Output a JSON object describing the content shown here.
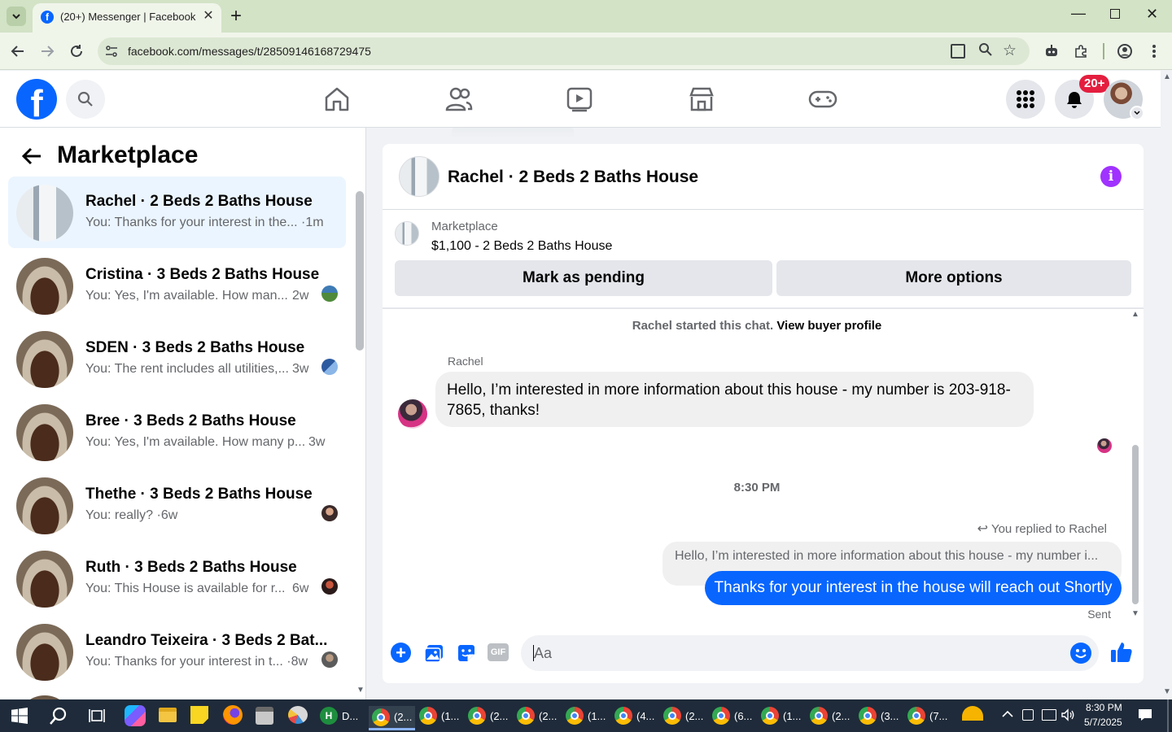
{
  "browser": {
    "tab_title": "(20+) Messenger | Facebook",
    "new_tab": "+",
    "url": "facebook.com/messages/t/28509146168729475"
  },
  "nav": {
    "notification_badge": "20+"
  },
  "left": {
    "title": "Marketplace",
    "conversations": [
      {
        "title": "Rachel · 2 Beds 2 Baths House",
        "preview": "You: Thanks for your interest in the...",
        "time": "·1m"
      },
      {
        "title": "Cristina · 3 Beds 2 Baths House",
        "preview": "You: Yes, I'm available. How man...",
        "time": "2w"
      },
      {
        "title": "SDEN · 3 Beds 2 Baths House",
        "preview": "You: The rent includes all utilities,...",
        "time": "3w"
      },
      {
        "title": "Bree · 3 Beds 2 Baths House",
        "preview": "You: Yes, I'm available. How many p...",
        "time": "3w"
      },
      {
        "title": "Thethe · 3 Beds 2 Baths House",
        "preview": "You: really?",
        "time": "·6w"
      },
      {
        "title": "Ruth · 3 Beds 2 Baths House",
        "preview": "You: This House is available for r...",
        "time": "6w"
      },
      {
        "title": "Leandro Teixeira · 3 Beds 2 Bat...",
        "preview": "You: Thanks for your interest in t...",
        "time": "·8w"
      }
    ]
  },
  "chat": {
    "header_title": "Rachel · 2 Beds 2 Baths House",
    "listing_source": "Marketplace",
    "listing_title": "$1,100 - 2 Beds 2 Baths House",
    "mark_pending": "Mark as pending",
    "more_options": "More options",
    "started_text": "Rachel started this chat.",
    "view_profile": "View buyer profile",
    "sender_name": "Rachel",
    "incoming_line1": "Hello, I’m interested in more information about this house - my number is 203-918-",
    "incoming_line2": "7865, thanks!",
    "timestamp": "8:30 PM",
    "replied_to": "You replied to Rachel",
    "quoted": "Hello, I’m interested in more information about this house - my number i...",
    "outgoing": "Thanks for your interest in the house will reach out Shortly",
    "status": "Sent",
    "composer_placeholder": "Aa",
    "gif_label": "GIF"
  },
  "taskbar": {
    "apps": [
      "D...",
      "(2...",
      "(1...",
      "(2...",
      "(2...",
      "(1...",
      "(4...",
      "(2...",
      "(6...",
      "(1...",
      "(2...",
      "(3...",
      "(7..."
    ],
    "time": "8:30 PM",
    "date": "5/7/2025"
  },
  "colors": {
    "fb_blue": "#0866ff",
    "purple_info": "#a033ff",
    "selected_row": "#ebf5ff"
  }
}
